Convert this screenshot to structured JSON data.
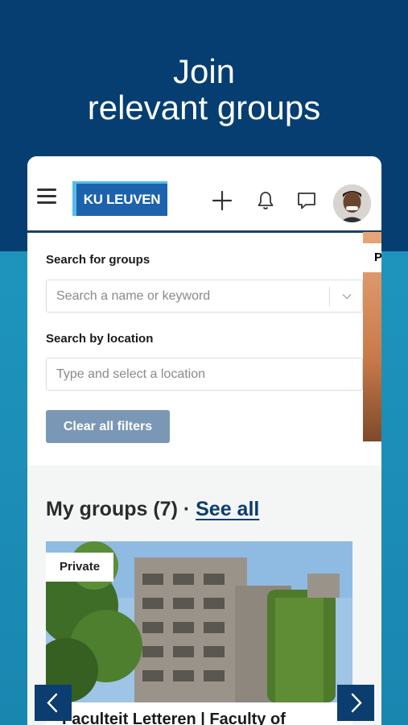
{
  "headline": {
    "line1": "Join",
    "line2": "relevant groups"
  },
  "header": {
    "logo_text": "KU LEUVEN",
    "icons": [
      "menu-icon",
      "plus-icon",
      "bell-icon",
      "chat-icon",
      "avatar"
    ]
  },
  "search": {
    "groups_label": "Search for groups",
    "groups_placeholder": "Search a name or keyword",
    "location_label": "Search by location",
    "location_placeholder": "Type and select a location",
    "clear_label": "Clear all filters"
  },
  "groups": {
    "title": "My groups (7) · ",
    "see_all": "See all",
    "cards": [
      {
        "badge": "Private",
        "title": "Faculteit Letteren | Faculty of"
      },
      {
        "badge": "P"
      }
    ]
  },
  "colors": {
    "top_bg": "#063e72",
    "bottom_bg": "#1a8db5",
    "brand_blue": "#1d62ac",
    "button_disabled": "#7a98b5",
    "nav_button": "#0b3d70"
  }
}
